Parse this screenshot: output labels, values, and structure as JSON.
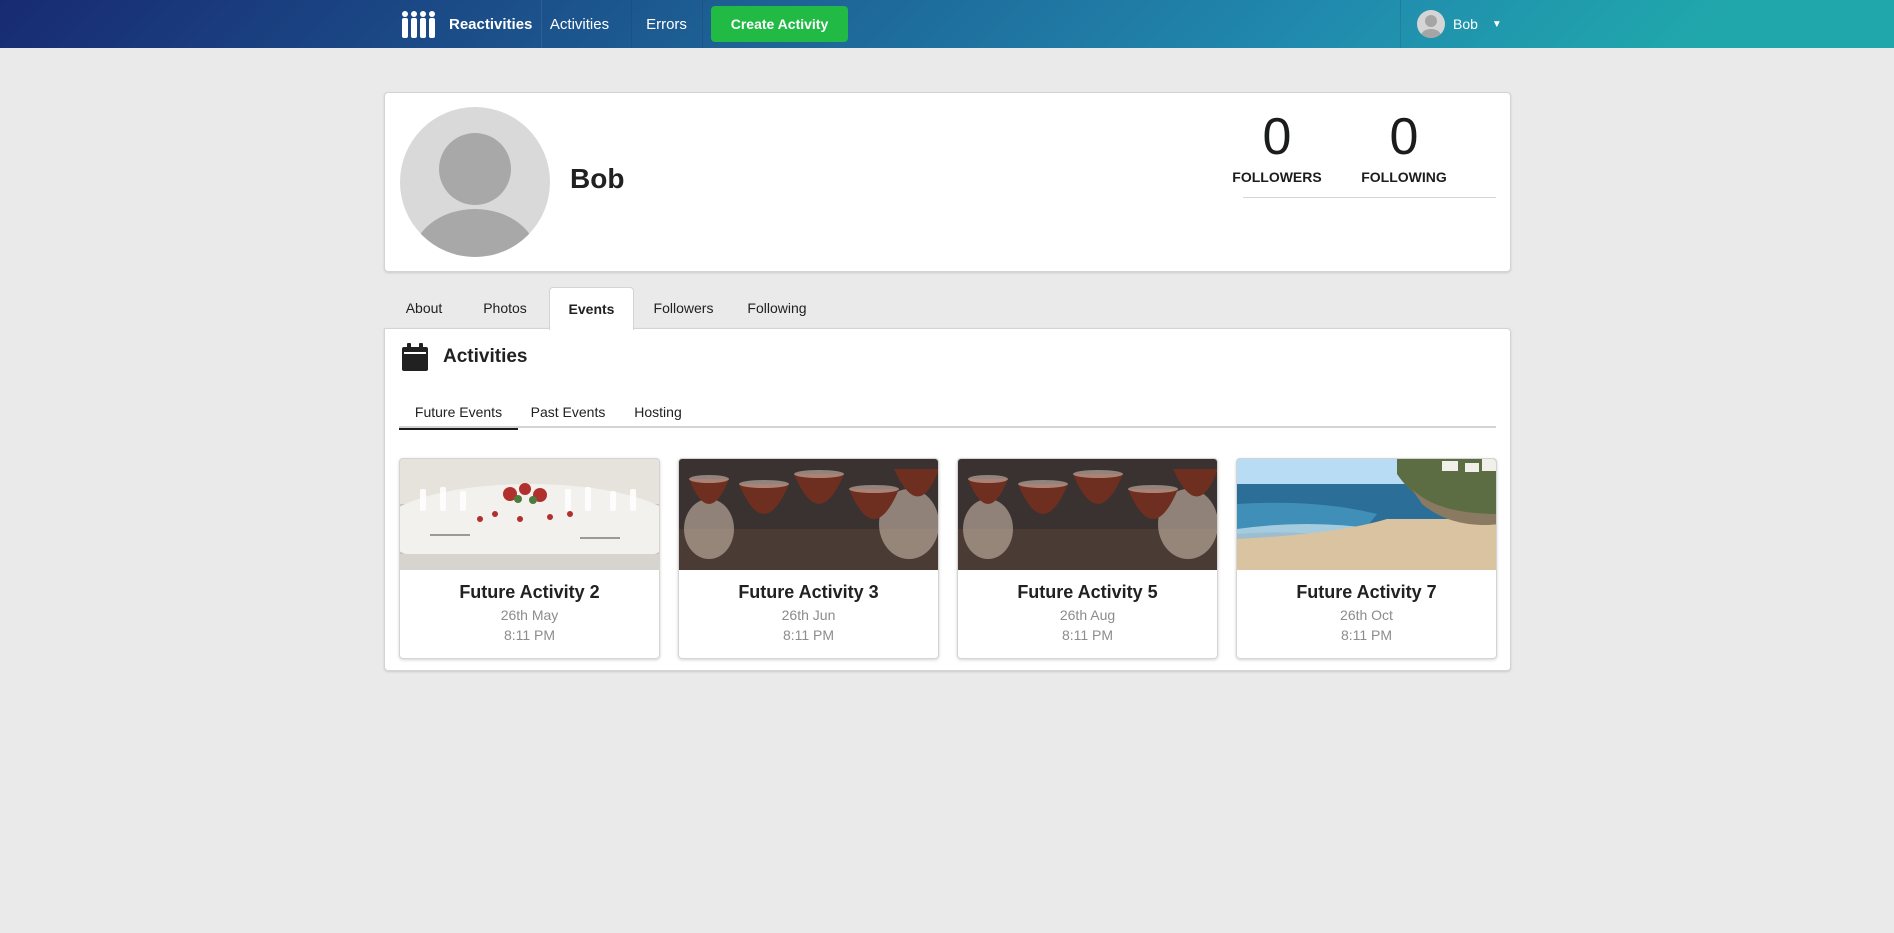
{
  "nav": {
    "brand": "Reactivities",
    "activities": "Activities",
    "errors": "Errors",
    "create_activity": "Create Activity",
    "user_name": "Bob",
    "logo_icon": "people-group-icon",
    "caret_icon": "caret-down-icon",
    "gradient_colors": [
      "#182a73",
      "#218aae",
      "#20a7ac"
    ]
  },
  "profile": {
    "name": "Bob",
    "followers_count": "0",
    "followers_label": "FOLLOWERS",
    "following_count": "0",
    "following_label": "FOLLOWING"
  },
  "tabs": [
    {
      "label": "About",
      "active": false
    },
    {
      "label": "Photos",
      "active": false
    },
    {
      "label": "Events",
      "active": true
    },
    {
      "label": "Followers",
      "active": false
    },
    {
      "label": "Following",
      "active": false
    }
  ],
  "events_pane": {
    "title": "Activities",
    "icon": "calendar-icon",
    "subtabs": [
      {
        "label": "Future Events",
        "active": true
      },
      {
        "label": "Past Events",
        "active": false
      },
      {
        "label": "Hosting",
        "active": false
      }
    ],
    "cards": [
      {
        "title": "Future Activity 2",
        "date": "26th May",
        "time": "8:11 PM",
        "image": "dinner-table"
      },
      {
        "title": "Future Activity 3",
        "date": "26th Jun",
        "time": "8:11 PM",
        "image": "drinks-toast"
      },
      {
        "title": "Future Activity 5",
        "date": "26th Aug",
        "time": "8:11 PM",
        "image": "drinks-toast"
      },
      {
        "title": "Future Activity 7",
        "date": "26th Oct",
        "time": "8:11 PM",
        "image": "beach-coast"
      }
    ]
  },
  "colors": {
    "create_button": "#21ba45",
    "page_background": "#eaeaea"
  }
}
